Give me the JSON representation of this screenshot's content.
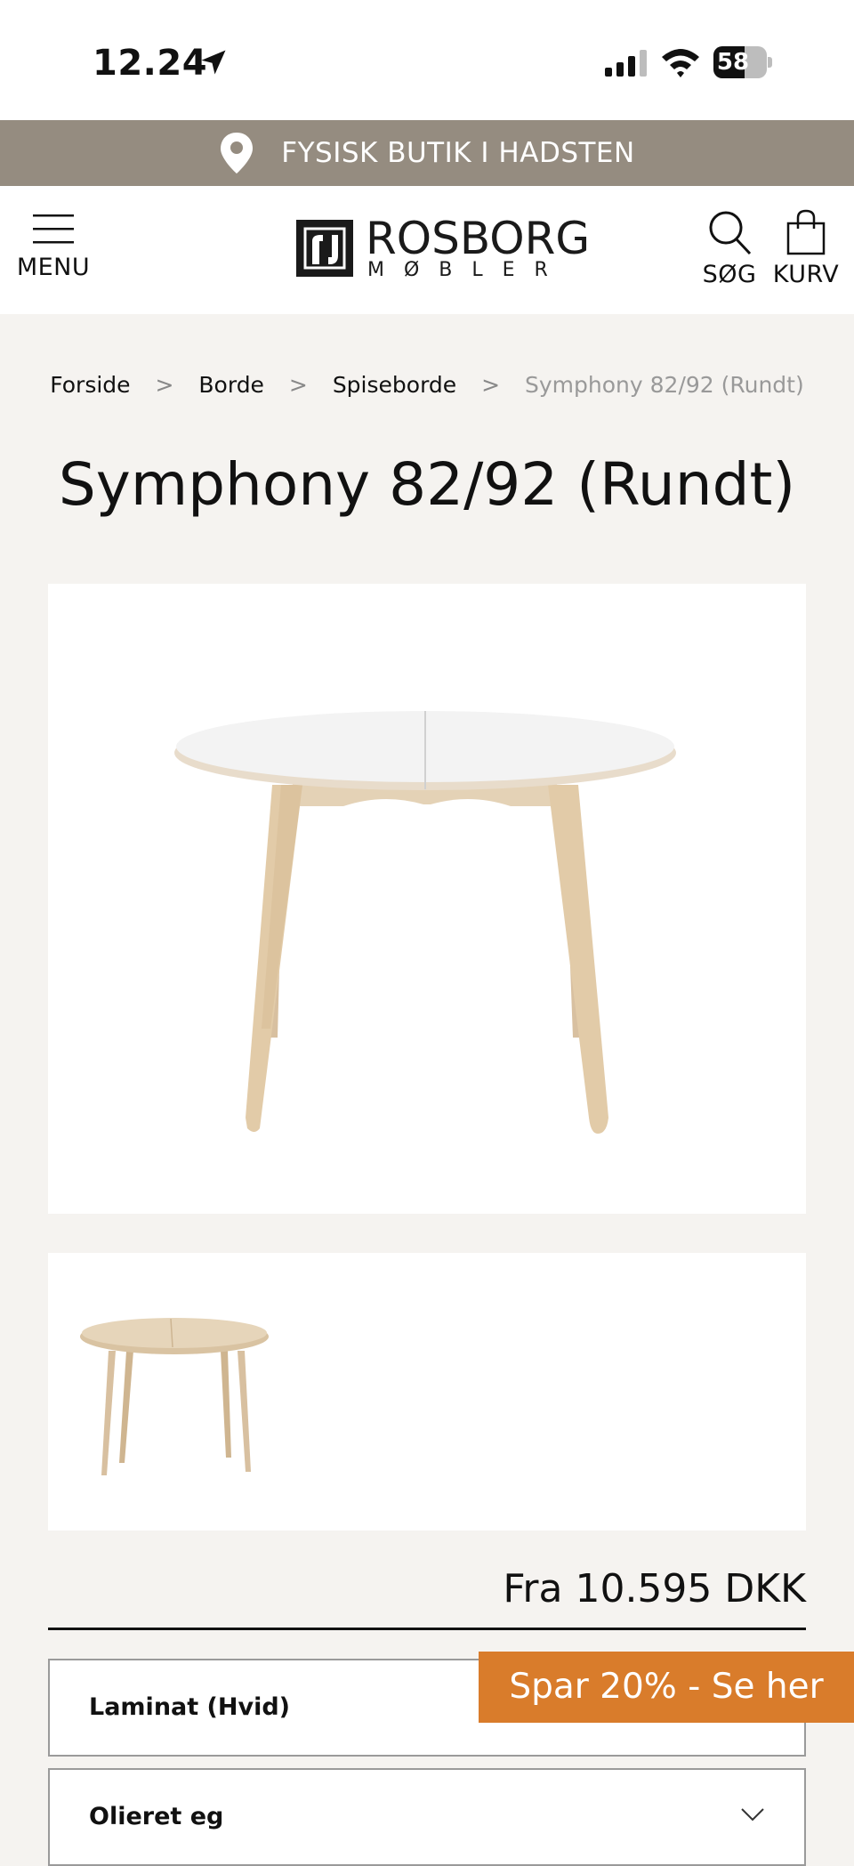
{
  "status_bar": {
    "time": "12.24",
    "battery_level": "58",
    "battery_fraction": 0.58
  },
  "banner": {
    "text": "FYSISK BUTIK I HADSTEN",
    "color": "#958c80",
    "icon": "map-pin-icon"
  },
  "header": {
    "menu_label": "MENU",
    "brand_name": "ROSBORG",
    "brand_sub": "MØBLER",
    "search_label": "SØG",
    "cart_label": "KURV"
  },
  "breadcrumb": {
    "items": [
      "Forside",
      "Borde",
      "Spiseborde"
    ],
    "separator": ">",
    "current": "Symphony 82/92 (Rundt)"
  },
  "product": {
    "title": "Symphony 82/92 (Rundt)",
    "price": "Fra 10.595 DKK",
    "main_image": "round-extending-table-white-laminate",
    "thumbnails": [
      "round-extending-table-oiled-oak"
    ]
  },
  "options": [
    {
      "label": "Laminat (Hvid)"
    },
    {
      "label": "Olieret eg"
    }
  ],
  "promo": {
    "text": "Spar 20% - Se her",
    "color": "#d97c2b"
  }
}
